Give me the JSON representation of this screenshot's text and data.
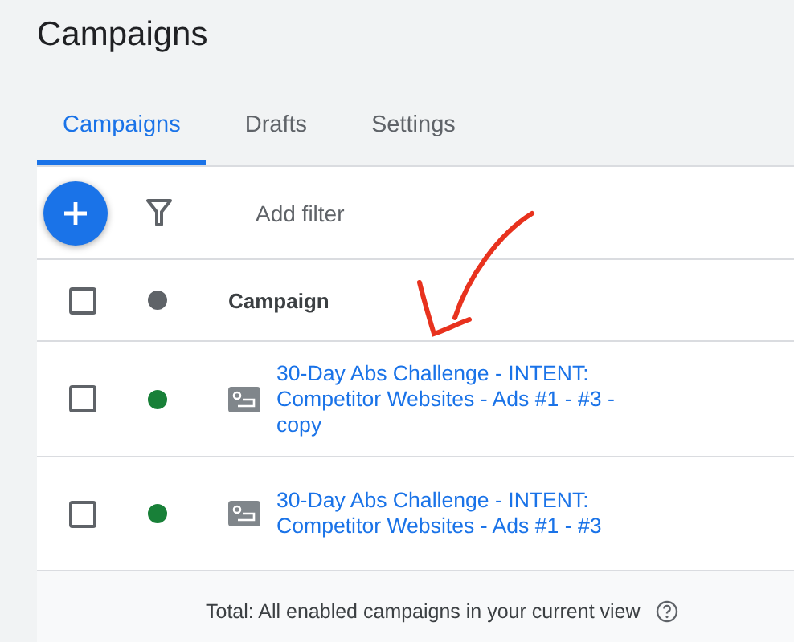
{
  "page_title": "Campaigns",
  "tabs": [
    {
      "label": "Campaigns",
      "selected": true
    },
    {
      "label": "Drafts",
      "selected": false
    },
    {
      "label": "Settings",
      "selected": false
    }
  ],
  "toolbar": {
    "filter_label": "Add filter"
  },
  "table": {
    "header": {
      "checked": false,
      "label": "Campaign"
    },
    "rows": [
      {
        "checked": false,
        "color": "#188038",
        "name": "30-Day Abs Challenge - INTENT: Competitor Websites - Ads #1 - #3 - copy"
      },
      {
        "checked": false,
        "color": "#188038",
        "name": "30-Day Abs Challenge - INTENT: Competitor Websites - Ads #1 - #3"
      }
    ]
  },
  "footer": {
    "total": "Total: All enabled campaigns in your current view"
  }
}
